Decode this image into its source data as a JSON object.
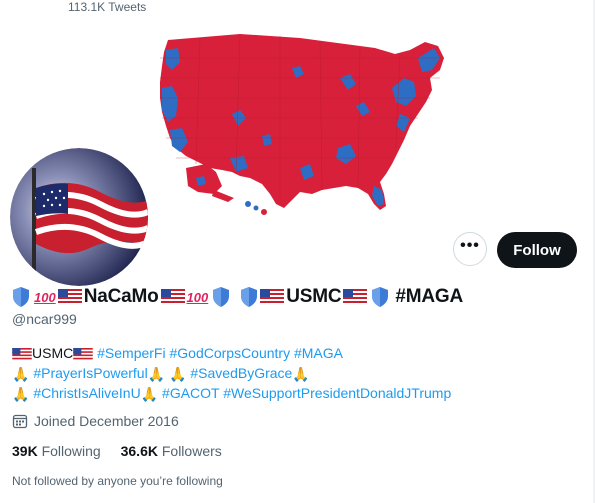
{
  "header": {
    "tweet_count": "113.1K Tweets"
  },
  "banner": {
    "image": "us-electoral-county-map",
    "colors": {
      "republican": "#d8203a",
      "democrat": "#2e6dc4"
    }
  },
  "profile": {
    "display_name": "NaCaMo",
    "name_suffix": "USMC",
    "name_tag": "#MAGA",
    "handle": "@ncar999",
    "follow_label": "Follow",
    "more_label": "•••",
    "bio": {
      "line1_prefix": "USMC",
      "line1_tags": "#SemperFi #GodCorpsCountry #MAGA",
      "line2_tag1": "#PrayerIsPowerful",
      "line2_tag2": "#SavedByGrace",
      "line3_tag1": "#ChristIsAliveInU",
      "line3_tags": "#GACOT #WeSupportPresidentDonaldJTrump"
    },
    "joined": "Joined December 2016",
    "following_count": "39K",
    "following_label": "Following",
    "followers_count": "36.6K",
    "followers_label": "Followers",
    "not_followed": "Not followed by anyone you’re following"
  },
  "colors": {
    "link": "#1d9bf0",
    "text": "#0f1419",
    "muted": "#536471",
    "shield": "#3d7bd6"
  }
}
